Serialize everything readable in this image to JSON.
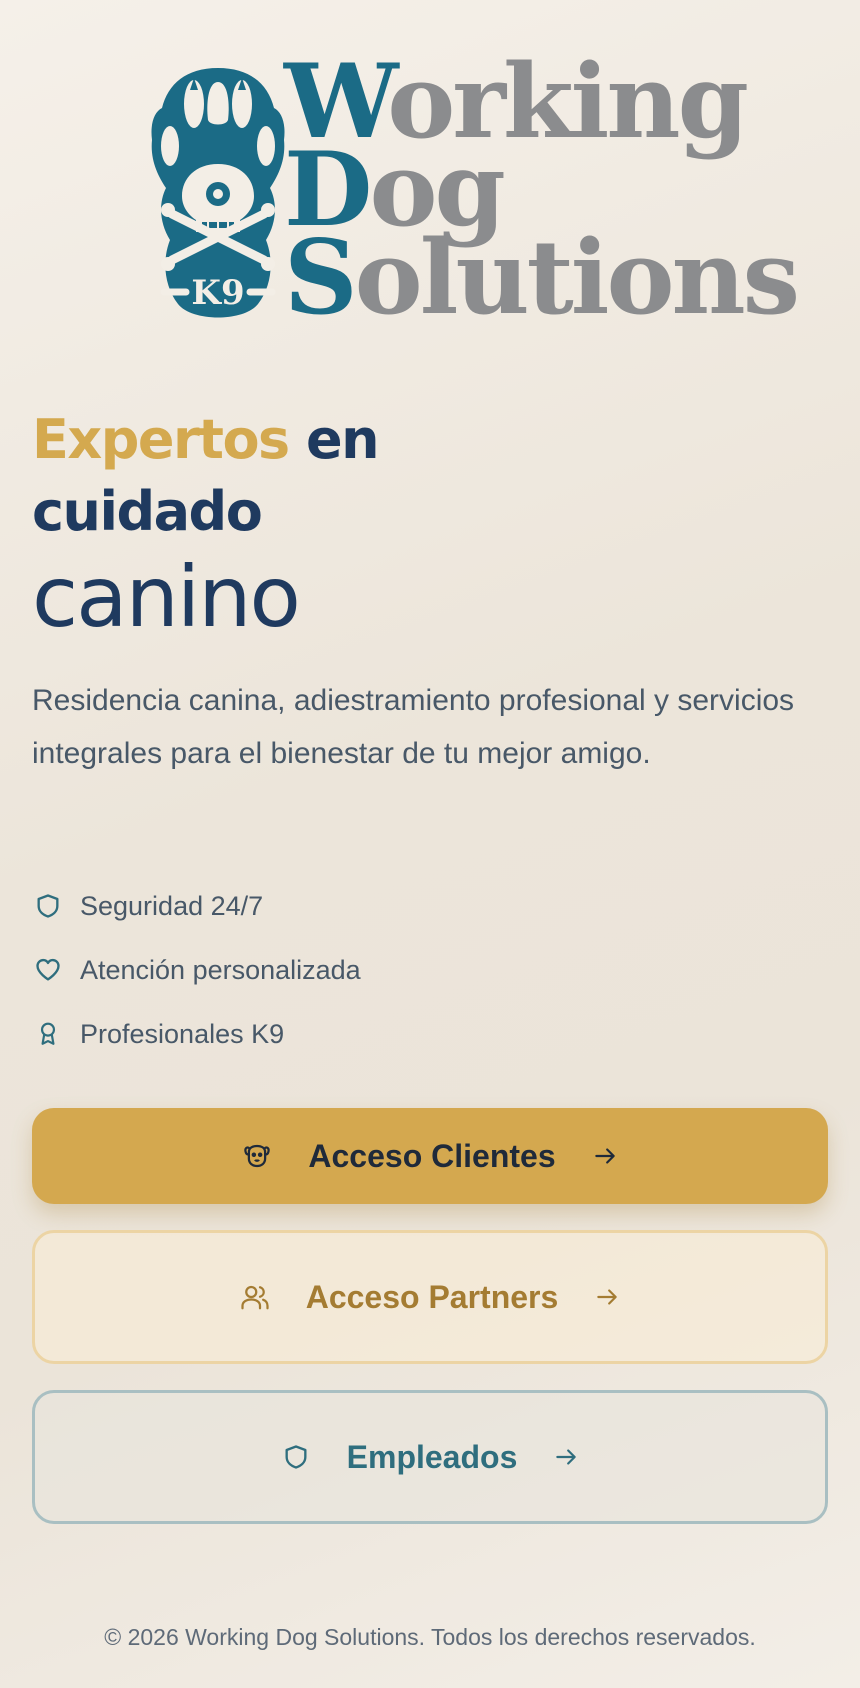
{
  "brand": {
    "logo_lines": [
      {
        "cap": "W",
        "rest": "orking"
      },
      {
        "cap": "D",
        "rest": "og"
      },
      {
        "cap": "S",
        "rest": "olutions"
      }
    ],
    "badge_text": "K9",
    "colors": {
      "teal": "#1b6b86",
      "gray": "#8b8c8e",
      "gold": "#d4a94f",
      "navy": "#1f3a5f"
    }
  },
  "hero": {
    "headline_accent": "Expertos",
    "headline_rest": "en",
    "headline_line2": "cuidado",
    "headline_line3": "canino",
    "description": "Residencia canina, adiestramiento profesional y servicios integrales para el bienestar de tu mejor amigo."
  },
  "features": [
    {
      "icon": "shield-icon",
      "label": "Seguridad 24/7"
    },
    {
      "icon": "heart-icon",
      "label": "Atención personalizada"
    },
    {
      "icon": "award-icon",
      "label": "Profesionales K9"
    }
  ],
  "buttons": {
    "clientes": {
      "label": "Acceso Clientes",
      "icon": "dog-icon",
      "color": "#d4a84f"
    },
    "partners": {
      "label": "Acceso Partners",
      "icon": "users-icon",
      "color": "#a47c32"
    },
    "empleados": {
      "label": "Empleados",
      "icon": "shield-icon",
      "color": "#2f6e7e"
    }
  },
  "footer": {
    "copyright": "© 2026 Working Dog Solutions. Todos los derechos reservados."
  }
}
